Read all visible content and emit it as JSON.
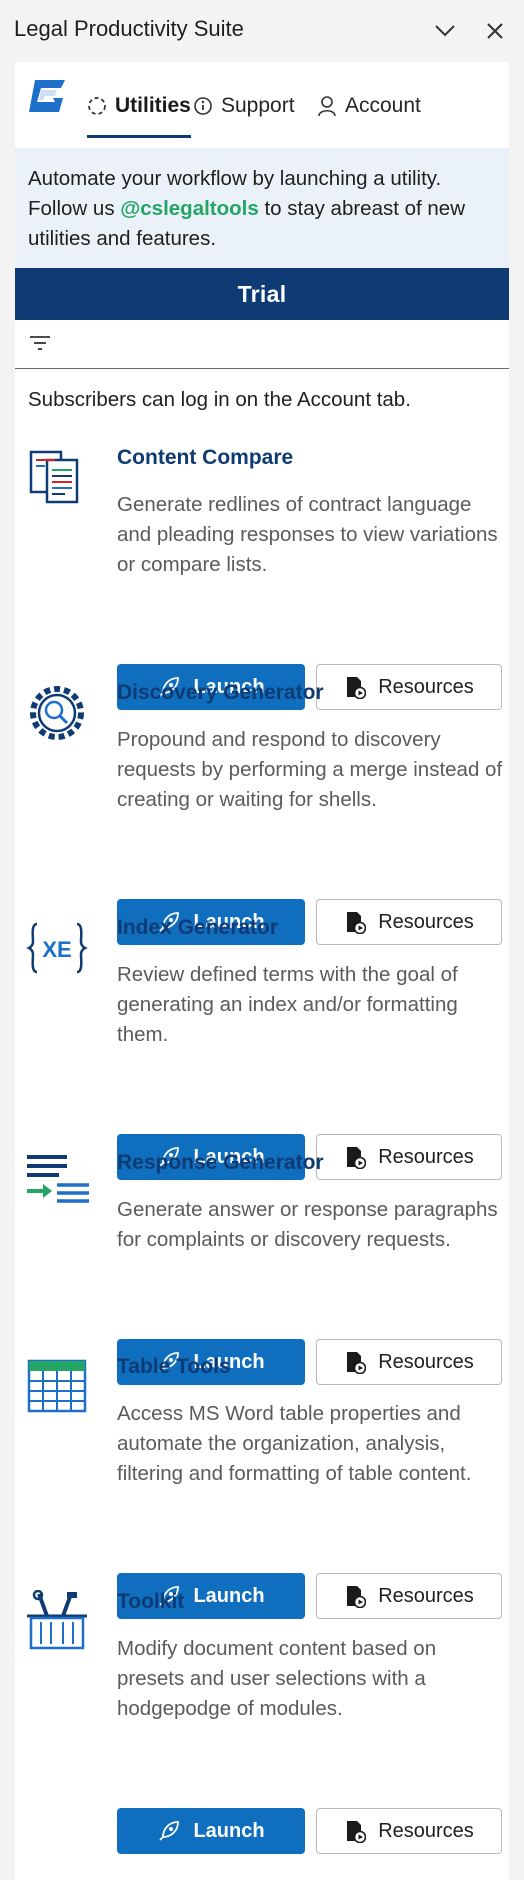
{
  "window": {
    "title": "Legal Productivity Suite",
    "collapse_icon": "chevron-down-icon",
    "close_icon": "close-icon"
  },
  "tabs": [
    {
      "label": "Utilities",
      "icon": "spinner-icon",
      "active": true
    },
    {
      "label": "Support",
      "icon": "info-icon",
      "active": false
    },
    {
      "label": "Account",
      "icon": "person-icon",
      "active": false
    }
  ],
  "banner": {
    "line_start": "Automate your workflow by launching a utility. Follow us ",
    "handle": "@cslegaltools",
    "line_end": " to stay abreast of new utilities and features."
  },
  "plan": {
    "label": "Trial"
  },
  "filter": {
    "icon": "filter-icon"
  },
  "subnote": "Subscribers can log in on the Account tab.",
  "buttons": {
    "launch": "Launch",
    "resources": "Resources"
  },
  "utilities": [
    {
      "name": "Content Compare",
      "description": "Generate redlines of contract language and pleading responses to view variations or compare lists.",
      "icon": "compare-docs-icon"
    },
    {
      "name": "Discovery Generator",
      "description": "Propound and respond to discovery requests by performing a merge instead of creating or waiting for shells.",
      "icon": "gear-search-icon"
    },
    {
      "name": "Index Generator",
      "description": "Review defined terms with the goal of generating an index and/or formatting them.",
      "icon": "xe-field-icon",
      "icon_text": "XE"
    },
    {
      "name": "Response Generator",
      "description": "Generate answer or response paragraphs for complaints or discovery requests.",
      "icon": "response-lines-icon"
    },
    {
      "name": "Table Tools",
      "description": "Access MS Word table properties and automate the organization, analysis, filtering and formatting of table content.",
      "icon": "table-icon"
    },
    {
      "name": "Toolkit",
      "description": "Modify document content based on presets and user selections with a hodgepodge of modules.",
      "icon": "toolbox-icon"
    }
  ],
  "colors": {
    "brand_navy": "#0f3b74",
    "launch_blue": "#106ebe",
    "handle_green": "#23a566",
    "banner_bg": "#eaf1f8"
  }
}
